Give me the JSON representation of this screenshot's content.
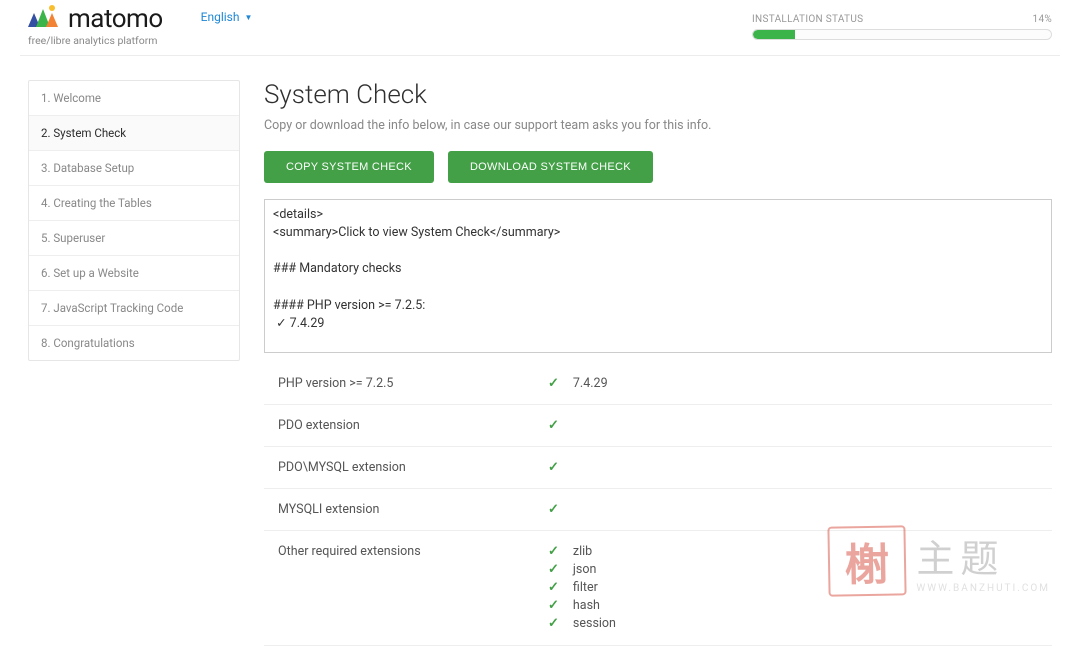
{
  "brand": {
    "name": "matomo",
    "tagline": "free/libre analytics platform"
  },
  "language": {
    "label": "English"
  },
  "status": {
    "label": "INSTALLATION STATUS",
    "percent_text": "14%",
    "percent_value": 14
  },
  "sidebar": {
    "active_index": 1,
    "items": [
      {
        "label": "1. Welcome"
      },
      {
        "label": "2. System Check"
      },
      {
        "label": "3. Database Setup"
      },
      {
        "label": "4. Creating the Tables"
      },
      {
        "label": "5. Superuser"
      },
      {
        "label": "6. Set up a Website"
      },
      {
        "label": "7. JavaScript Tracking Code"
      },
      {
        "label": "8. Congratulations"
      }
    ]
  },
  "content": {
    "title": "System Check",
    "subtitle": "Copy or download the info below, in case our support team asks you for this info.",
    "buttons": {
      "copy": "COPY SYSTEM CHECK",
      "download": "DOWNLOAD SYSTEM CHECK"
    },
    "details_text": "<details>\n<summary>Click to view System Check</summary>\n\n### Mandatory checks\n\n#### PHP version >= 7.2.5:\n ✓ 7.4.29\n\n#### PDO extension:\n ✓\n\n#### PDO\\MYSQL extension:"
  },
  "checks": [
    {
      "label": "PHP version >= 7.2.5",
      "value": "7.4.29"
    },
    {
      "label": "PDO extension",
      "value": ""
    },
    {
      "label": "PDO\\MYSQL extension",
      "value": ""
    },
    {
      "label": "MYSQLI extension",
      "value": ""
    }
  ],
  "other_ext": {
    "label": "Other required extensions",
    "items": [
      "zlib",
      "json",
      "filter",
      "hash",
      "session"
    ]
  },
  "watermark": {
    "stamp": "榭",
    "cn": "主题",
    "url": "WWW.BANZHUTI.COM"
  }
}
